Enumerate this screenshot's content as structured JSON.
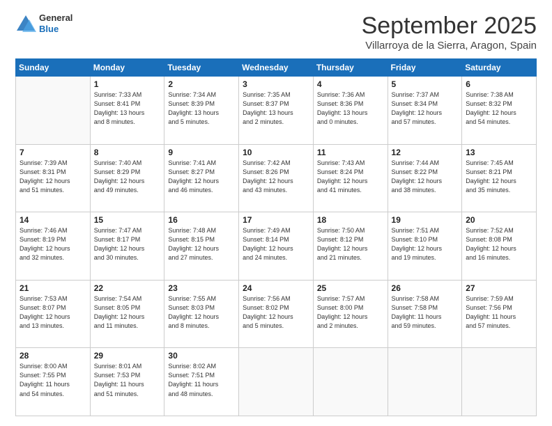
{
  "header": {
    "logo_general": "General",
    "logo_blue": "Blue",
    "month": "September 2025",
    "location": "Villarroya de la Sierra, Aragon, Spain"
  },
  "days_of_week": [
    "Sunday",
    "Monday",
    "Tuesday",
    "Wednesday",
    "Thursday",
    "Friday",
    "Saturday"
  ],
  "weeks": [
    [
      {
        "num": "",
        "info": ""
      },
      {
        "num": "1",
        "info": "Sunrise: 7:33 AM\nSunset: 8:41 PM\nDaylight: 13 hours\nand 8 minutes."
      },
      {
        "num": "2",
        "info": "Sunrise: 7:34 AM\nSunset: 8:39 PM\nDaylight: 13 hours\nand 5 minutes."
      },
      {
        "num": "3",
        "info": "Sunrise: 7:35 AM\nSunset: 8:37 PM\nDaylight: 13 hours\nand 2 minutes."
      },
      {
        "num": "4",
        "info": "Sunrise: 7:36 AM\nSunset: 8:36 PM\nDaylight: 13 hours\nand 0 minutes."
      },
      {
        "num": "5",
        "info": "Sunrise: 7:37 AM\nSunset: 8:34 PM\nDaylight: 12 hours\nand 57 minutes."
      },
      {
        "num": "6",
        "info": "Sunrise: 7:38 AM\nSunset: 8:32 PM\nDaylight: 12 hours\nand 54 minutes."
      }
    ],
    [
      {
        "num": "7",
        "info": "Sunrise: 7:39 AM\nSunset: 8:31 PM\nDaylight: 12 hours\nand 51 minutes."
      },
      {
        "num": "8",
        "info": "Sunrise: 7:40 AM\nSunset: 8:29 PM\nDaylight: 12 hours\nand 49 minutes."
      },
      {
        "num": "9",
        "info": "Sunrise: 7:41 AM\nSunset: 8:27 PM\nDaylight: 12 hours\nand 46 minutes."
      },
      {
        "num": "10",
        "info": "Sunrise: 7:42 AM\nSunset: 8:26 PM\nDaylight: 12 hours\nand 43 minutes."
      },
      {
        "num": "11",
        "info": "Sunrise: 7:43 AM\nSunset: 8:24 PM\nDaylight: 12 hours\nand 41 minutes."
      },
      {
        "num": "12",
        "info": "Sunrise: 7:44 AM\nSunset: 8:22 PM\nDaylight: 12 hours\nand 38 minutes."
      },
      {
        "num": "13",
        "info": "Sunrise: 7:45 AM\nSunset: 8:21 PM\nDaylight: 12 hours\nand 35 minutes."
      }
    ],
    [
      {
        "num": "14",
        "info": "Sunrise: 7:46 AM\nSunset: 8:19 PM\nDaylight: 12 hours\nand 32 minutes."
      },
      {
        "num": "15",
        "info": "Sunrise: 7:47 AM\nSunset: 8:17 PM\nDaylight: 12 hours\nand 30 minutes."
      },
      {
        "num": "16",
        "info": "Sunrise: 7:48 AM\nSunset: 8:15 PM\nDaylight: 12 hours\nand 27 minutes."
      },
      {
        "num": "17",
        "info": "Sunrise: 7:49 AM\nSunset: 8:14 PM\nDaylight: 12 hours\nand 24 minutes."
      },
      {
        "num": "18",
        "info": "Sunrise: 7:50 AM\nSunset: 8:12 PM\nDaylight: 12 hours\nand 21 minutes."
      },
      {
        "num": "19",
        "info": "Sunrise: 7:51 AM\nSunset: 8:10 PM\nDaylight: 12 hours\nand 19 minutes."
      },
      {
        "num": "20",
        "info": "Sunrise: 7:52 AM\nSunset: 8:08 PM\nDaylight: 12 hours\nand 16 minutes."
      }
    ],
    [
      {
        "num": "21",
        "info": "Sunrise: 7:53 AM\nSunset: 8:07 PM\nDaylight: 12 hours\nand 13 minutes."
      },
      {
        "num": "22",
        "info": "Sunrise: 7:54 AM\nSunset: 8:05 PM\nDaylight: 12 hours\nand 11 minutes."
      },
      {
        "num": "23",
        "info": "Sunrise: 7:55 AM\nSunset: 8:03 PM\nDaylight: 12 hours\nand 8 minutes."
      },
      {
        "num": "24",
        "info": "Sunrise: 7:56 AM\nSunset: 8:02 PM\nDaylight: 12 hours\nand 5 minutes."
      },
      {
        "num": "25",
        "info": "Sunrise: 7:57 AM\nSunset: 8:00 PM\nDaylight: 12 hours\nand 2 minutes."
      },
      {
        "num": "26",
        "info": "Sunrise: 7:58 AM\nSunset: 7:58 PM\nDaylight: 11 hours\nand 59 minutes."
      },
      {
        "num": "27",
        "info": "Sunrise: 7:59 AM\nSunset: 7:56 PM\nDaylight: 11 hours\nand 57 minutes."
      }
    ],
    [
      {
        "num": "28",
        "info": "Sunrise: 8:00 AM\nSunset: 7:55 PM\nDaylight: 11 hours\nand 54 minutes."
      },
      {
        "num": "29",
        "info": "Sunrise: 8:01 AM\nSunset: 7:53 PM\nDaylight: 11 hours\nand 51 minutes."
      },
      {
        "num": "30",
        "info": "Sunrise: 8:02 AM\nSunset: 7:51 PM\nDaylight: 11 hours\nand 48 minutes."
      },
      {
        "num": "",
        "info": ""
      },
      {
        "num": "",
        "info": ""
      },
      {
        "num": "",
        "info": ""
      },
      {
        "num": "",
        "info": ""
      }
    ]
  ]
}
